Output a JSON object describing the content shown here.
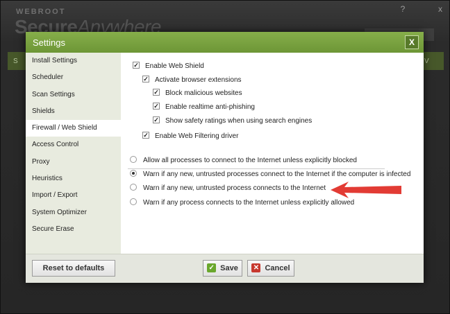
{
  "app": {
    "brand_small": "WEBROOT",
    "brand_main": "Secure",
    "brand_thin": "Anywhere",
    "help": "?",
    "close": "x",
    "edge_left": "S",
    "edge_right": "V"
  },
  "dialog": {
    "title": "Settings",
    "close_label": "X"
  },
  "sidebar": {
    "items": [
      {
        "label": "Install Settings"
      },
      {
        "label": "Scheduler"
      },
      {
        "label": "Scan Settings"
      },
      {
        "label": "Shields"
      },
      {
        "label": "Firewall / Web Shield"
      },
      {
        "label": "Access Control"
      },
      {
        "label": "Proxy"
      },
      {
        "label": "Heuristics"
      },
      {
        "label": "Import / Export"
      },
      {
        "label": "System Optimizer"
      },
      {
        "label": "Secure Erase"
      }
    ],
    "active": "Firewall / Web Shield"
  },
  "options": {
    "enable_web_shield": {
      "label": "Enable Web Shield",
      "checked": true
    },
    "activate_extensions": {
      "label": "Activate browser extensions",
      "checked": true
    },
    "block_malicious": {
      "label": "Block malicious websites",
      "checked": true
    },
    "anti_phishing": {
      "label": "Enable realtime anti-phishing",
      "checked": true
    },
    "safety_ratings": {
      "label": "Show safety ratings when using search engines",
      "checked": true
    },
    "web_filtering": {
      "label": "Enable Web Filtering driver",
      "checked": true
    }
  },
  "firewall": {
    "options": [
      {
        "label": "Allow all processes to connect to the Internet unless explicitly blocked",
        "selected": false
      },
      {
        "label": "Warn if any new, untrusted processes connect to the Internet if the computer is infected",
        "selected": true
      },
      {
        "label": "Warn if any new, untrusted process connects to the Internet",
        "selected": false
      },
      {
        "label": "Warn if any process connects to the Internet unless explicitly allowed",
        "selected": false
      }
    ]
  },
  "footer": {
    "reset_label": "Reset to defaults",
    "save_label": "Save",
    "cancel_label": "Cancel"
  },
  "colors": {
    "accent_green": "#6d9636",
    "annotation_arrow": "#e23b34"
  },
  "icons": {
    "save": "check-icon",
    "cancel": "x-icon"
  }
}
